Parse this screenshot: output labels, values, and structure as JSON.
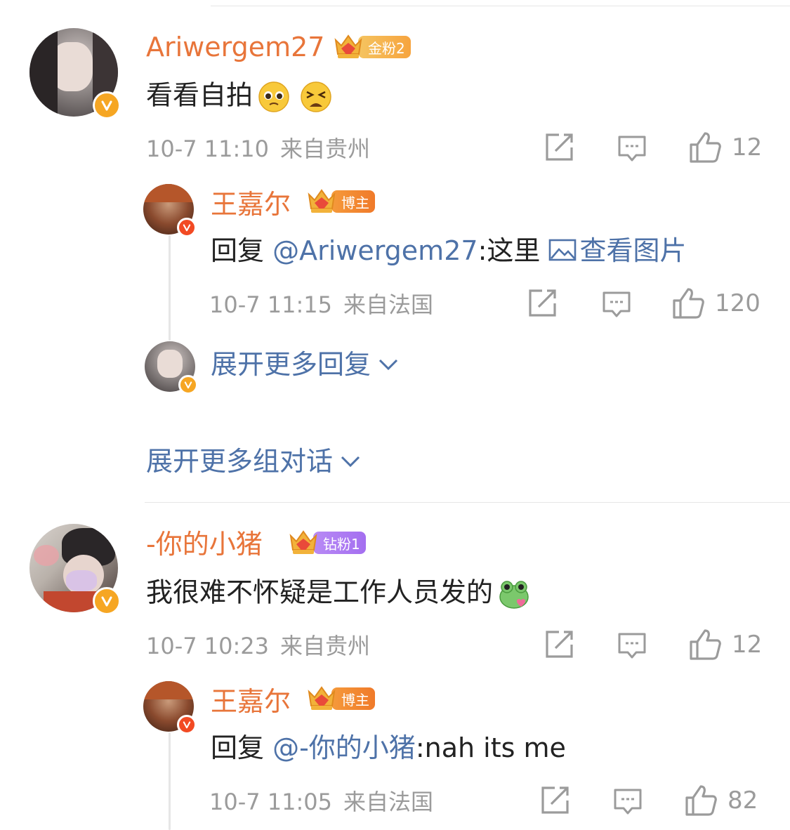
{
  "comments": [
    {
      "username": "Ariwergem27",
      "rank_label": "金粉2",
      "rank_level": "3",
      "text": "看看自拍",
      "meta_date": "10-7 11:10",
      "meta_location": "来自贵州",
      "likes": "12",
      "reply": {
        "username": "王嘉尔",
        "rank_label": "博主",
        "rank_level": "7",
        "prefix": "回复 ",
        "mention": "@Ariwergem27",
        "text": ":这里 ",
        "link": "查看图片",
        "meta_date": "10-7 11:15",
        "meta_location": "来自法国",
        "likes": "120"
      },
      "more_replies": "展开更多回复"
    },
    {
      "username": "-你的小猪",
      "rank_label": "钻粉1",
      "rank_level": "6",
      "text": "我很难不怀疑是工作人员发的",
      "meta_date": "10-7 10:23",
      "meta_location": "来自贵州",
      "likes": "12",
      "reply": {
        "username": "王嘉尔",
        "rank_label": "博主",
        "rank_level": "7",
        "prefix": "回复 ",
        "mention": "@-你的小猪",
        "text": ":nah its me",
        "meta_date": "10-7 11:05",
        "meta_location": "来自法国",
        "likes": "82"
      }
    }
  ],
  "more_conversations": "展开更多组对话",
  "colors": {
    "username": "#e8753a",
    "link": "#4e72a8",
    "meta": "#9b9b9b",
    "verified_gold": "#f6a623",
    "verified_red": "#f24a23"
  },
  "icons": [
    "verified-v-icon",
    "crown-icon",
    "pleading-face-emoji",
    "tired-face-emoji",
    "frog-emoji",
    "image-icon",
    "share-icon",
    "comment-icon",
    "like-icon",
    "chevron-down-icon"
  ]
}
